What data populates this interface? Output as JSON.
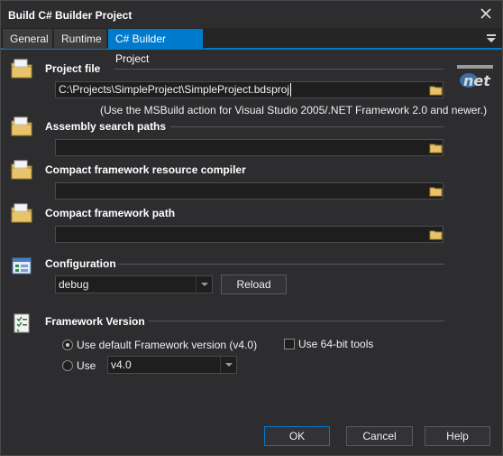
{
  "window": {
    "title": "Build C# Builder Project"
  },
  "tabs": [
    {
      "label": "General"
    },
    {
      "label": "Runtime"
    },
    {
      "label": "C# Builder Project"
    }
  ],
  "project_file": {
    "heading": "Project file",
    "value": "C:\\Projects\\SimpleProject\\SimpleProject.bdsproj",
    "note": "(Use the MSBuild action for Visual Studio 2005/.NET Framework 2.0 and newer.)"
  },
  "assembly_search_paths": {
    "heading": "Assembly search paths",
    "value": ""
  },
  "compact_resource_compiler": {
    "heading": "Compact framework resource compiler",
    "value": ""
  },
  "compact_framework_path": {
    "heading": "Compact framework path",
    "value": ""
  },
  "configuration": {
    "heading": "Configuration",
    "value": "debug",
    "reload_label": "Reload"
  },
  "framework_version": {
    "heading": "Framework Version",
    "default_label": "Use default Framework version (v4.0)",
    "use_label": "Use",
    "use_value": "v4.0",
    "use64_label": "Use 64-bit tools",
    "selected": "default",
    "use64_checked": false
  },
  "buttons": {
    "ok": "OK",
    "cancel": "Cancel",
    "help": "Help"
  },
  "colors": {
    "accent": "#007acc",
    "background": "#2d2d30",
    "field": "#1e1e1e"
  }
}
